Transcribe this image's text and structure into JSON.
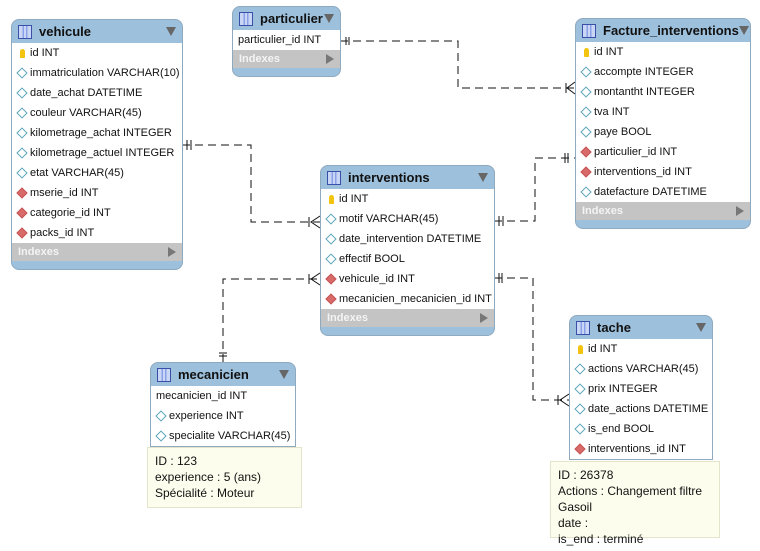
{
  "tables": {
    "vehicule": {
      "name": "vehicule",
      "indexes": "Indexes",
      "columns": [
        {
          "icon": "key",
          "label": "id INT"
        },
        {
          "icon": "diamond",
          "label": "immatriculation VARCHAR(10)"
        },
        {
          "icon": "diamond",
          "label": "date_achat DATETIME"
        },
        {
          "icon": "diamond",
          "label": "couleur VARCHAR(45)"
        },
        {
          "icon": "diamond",
          "label": "kilometrage_achat INTEGER"
        },
        {
          "icon": "diamond",
          "label": "kilometrage_actuel INTEGER"
        },
        {
          "icon": "diamond",
          "label": "etat VARCHAR(45)"
        },
        {
          "icon": "fk",
          "label": "mserie_id INT"
        },
        {
          "icon": "fk",
          "label": "categorie_id INT"
        },
        {
          "icon": "fk",
          "label": "packs_id INT"
        }
      ]
    },
    "particulier": {
      "name": "particulier",
      "indexes": "Indexes",
      "columns": [
        {
          "icon": "none",
          "label": "particulier_id INT"
        }
      ]
    },
    "facture": {
      "name": "Facture_interventions",
      "indexes": "Indexes",
      "columns": [
        {
          "icon": "key",
          "label": "id INT"
        },
        {
          "icon": "diamond",
          "label": "accompte INTEGER"
        },
        {
          "icon": "diamond",
          "label": "montantht INTEGER"
        },
        {
          "icon": "diamond",
          "label": "tva INT"
        },
        {
          "icon": "diamond",
          "label": "paye BOOL"
        },
        {
          "icon": "fk",
          "label": "particulier_id INT"
        },
        {
          "icon": "fk",
          "label": "interventions_id INT"
        },
        {
          "icon": "diamond",
          "label": "datefacture DATETIME"
        }
      ]
    },
    "interventions": {
      "name": "interventions",
      "indexes": "Indexes",
      "columns": [
        {
          "icon": "key",
          "label": "id INT"
        },
        {
          "icon": "diamond",
          "label": "motif VARCHAR(45)"
        },
        {
          "icon": "diamond",
          "label": "date_intervention DATETIME"
        },
        {
          "icon": "diamond",
          "label": "effectif BOOL"
        },
        {
          "icon": "fk",
          "label": "vehicule_id INT"
        },
        {
          "icon": "fk",
          "label": "mecanicien_mecanicien_id INT"
        }
      ]
    },
    "mecanicien": {
      "name": "mecanicien",
      "columns": [
        {
          "icon": "none",
          "label": "mecanicien_id INT"
        },
        {
          "icon": "diamond",
          "label": "experience INT"
        },
        {
          "icon": "diamond",
          "label": "specialite VARCHAR(45)"
        }
      ]
    },
    "tache": {
      "name": "tache",
      "columns": [
        {
          "icon": "key",
          "label": "id INT"
        },
        {
          "icon": "diamond",
          "label": "actions VARCHAR(45)"
        },
        {
          "icon": "diamond",
          "label": "prix INTEGER"
        },
        {
          "icon": "diamond",
          "label": "date_actions DATETIME"
        },
        {
          "icon": "diamond",
          "label": "is_end BOOL"
        },
        {
          "icon": "fk",
          "label": "interventions_id INT"
        }
      ]
    }
  },
  "notes": {
    "mecanicien": [
      "ID : 123",
      "experience : 5 (ans)",
      "Spécialité : Moteur"
    ],
    "tache": [
      "ID : 26378",
      "Actions : Changement filtre Gasoil",
      "date :",
      "is_end : terminé"
    ]
  },
  "relationships": [
    {
      "from": "particulier",
      "to": "Facture_interventions",
      "type": "one-to-many"
    },
    {
      "from": "vehicule",
      "to": "interventions",
      "type": "one-to-many"
    },
    {
      "from": "interventions",
      "to": "Facture_interventions",
      "type": "one-to-one"
    },
    {
      "from": "mecanicien",
      "to": "interventions",
      "type": "one-to-many"
    },
    {
      "from": "interventions",
      "to": "tache",
      "type": "one-to-many"
    }
  ]
}
